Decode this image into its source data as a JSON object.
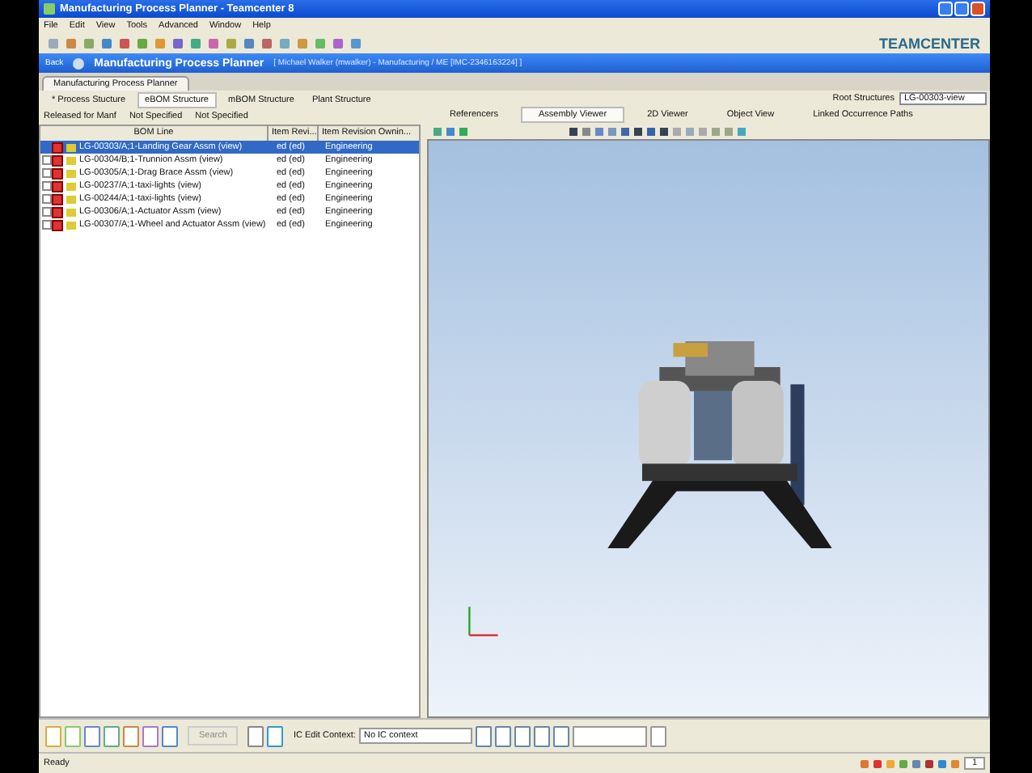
{
  "window": {
    "title": "Manufacturing Process Planner - Teamcenter 8"
  },
  "menu": [
    "File",
    "Edit",
    "View",
    "Tools",
    "Advanced",
    "Window",
    "Help"
  ],
  "logo": "TEAMCENTER",
  "nav": {
    "back": "Back",
    "app": "Manufacturing Process Planner",
    "context": "[ Michael Walker (mwalker) - Manufacturing / ME  [IMC-2346163224] ]"
  },
  "view_tab": "Manufacturing Process Planner",
  "structure_tabs": [
    {
      "label": "* Process Stucture",
      "selected": false
    },
    {
      "label": "eBOM Structure",
      "selected": true
    },
    {
      "label": "mBOM Structure",
      "selected": false
    },
    {
      "label": "Plant Structure",
      "selected": false
    }
  ],
  "filters": [
    "Released for Manf",
    "Not Specified",
    "Not Specified"
  ],
  "root_structures": {
    "label": "Root Structures",
    "value": "LG-00303-view"
  },
  "table": {
    "columns": [
      "BOM Line",
      "Item Revi...",
      "Item Revision Ownin..."
    ],
    "rows": [
      {
        "line": "LG-00303/A;1-Landing Gear Assm (view)",
        "revision": "ed (ed)",
        "owner": "Engineering",
        "selected": true,
        "expandable": false
      },
      {
        "line": "LG-00304/B;1-Trunnion Assm (view)",
        "revision": "ed (ed)",
        "owner": "Engineering",
        "selected": false,
        "expandable": true
      },
      {
        "line": "LG-00305/A;1-Drag Brace Assm (view)",
        "revision": "ed (ed)",
        "owner": "Engineering",
        "selected": false,
        "expandable": true
      },
      {
        "line": "LG-00237/A;1-taxi-lights (view)",
        "revision": "ed (ed)",
        "owner": "Engineering",
        "selected": false,
        "expandable": true
      },
      {
        "line": "LG-00244/A;1-taxi-lights (view)",
        "revision": "ed (ed)",
        "owner": "Engineering",
        "selected": false,
        "expandable": true
      },
      {
        "line": "LG-00306/A;1-Actuator Assm (view)",
        "revision": "ed (ed)",
        "owner": "Engineering",
        "selected": false,
        "expandable": true
      },
      {
        "line": "LG-00307/A;1-Wheel and Actuator Assm (view)",
        "revision": "ed (ed)",
        "owner": "Engineering",
        "selected": false,
        "expandable": true
      }
    ]
  },
  "viewer_tabs": [
    {
      "label": "Referencers",
      "selected": false
    },
    {
      "label": "Assembly Viewer",
      "selected": true
    },
    {
      "label": "2D Viewer",
      "selected": false
    },
    {
      "label": "Object View",
      "selected": false
    },
    {
      "label": "Linked Occurrence Paths",
      "selected": false
    }
  ],
  "bottom": {
    "search": "Search",
    "ic_label": "IC Edit Context:",
    "ic_value": "No IC context"
  },
  "status_bar": {
    "text": "Ready",
    "count": "1"
  }
}
